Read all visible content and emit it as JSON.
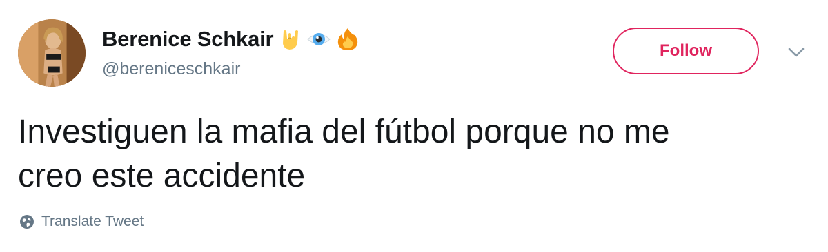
{
  "tweet": {
    "author": {
      "display_name": "Berenice Schkair",
      "handle": "@bereniceschkair",
      "name_emojis": [
        "horns-hand-emoji",
        "eye-emoji",
        "fire-emoji"
      ]
    },
    "follow_button": {
      "label": "Follow"
    },
    "more_menu": {
      "icon": "chevron-down-icon"
    },
    "text": "Investiguen la mafia del fútbol porque no me\ncreo este accidente",
    "translate": {
      "label": "Translate Tweet",
      "icon": "globe-icon"
    }
  },
  "colors": {
    "accent": "#e0245e",
    "text_primary": "#14171a",
    "text_secondary": "#657786"
  }
}
